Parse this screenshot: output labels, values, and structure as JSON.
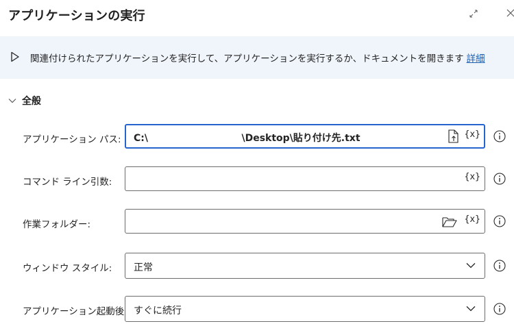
{
  "dialog": {
    "title": "アプリケーションの実行"
  },
  "description": {
    "text": "関連付けられたアプリケーションを実行して、アプリケーションを実行するか、ドキュメントを開きます",
    "link": "詳細"
  },
  "section": {
    "label": "全般"
  },
  "fields": {
    "app_path": {
      "label": "アプリケーション パス:",
      "value": "C:\\                            \\Desktop\\貼り付け先.txt",
      "var_label": "{x}"
    },
    "command_args": {
      "label": "コマンド ライン引数:",
      "value": "",
      "var_label": "{x}"
    },
    "work_folder": {
      "label": "作業フォルダー:",
      "value": "",
      "var_label": "{x}"
    },
    "window_style": {
      "label": "ウィンドウ スタイル:",
      "value": "正常"
    },
    "after_launch": {
      "label": "アプリケーション起動後:",
      "value": "すぐに続行"
    }
  }
}
